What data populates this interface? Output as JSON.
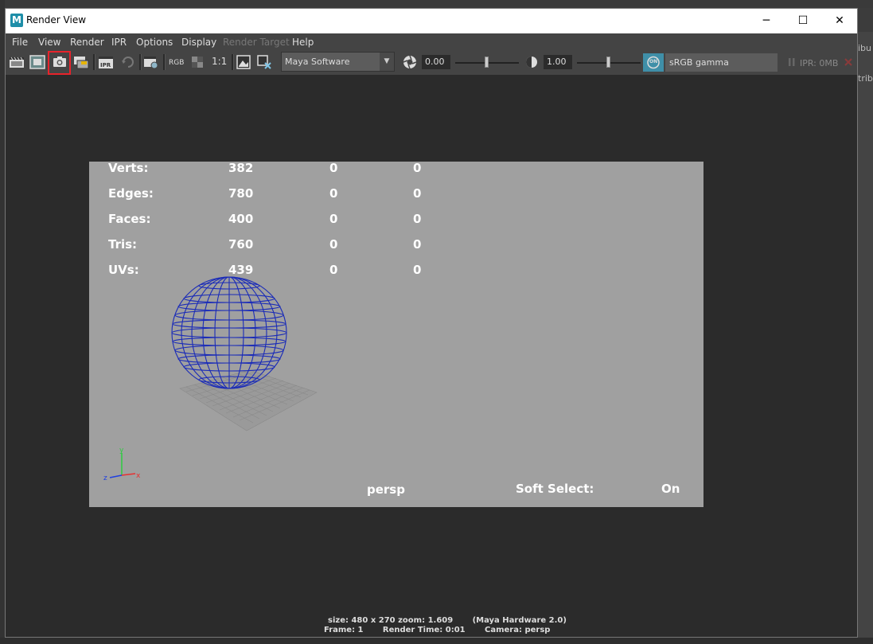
{
  "window": {
    "title": "Render View",
    "logo": "M",
    "minimize_icon": "─",
    "maximize_icon": "☐",
    "close_icon": "✕"
  },
  "menu": [
    "File",
    "View",
    "Render",
    "IPR",
    "Options",
    "Display",
    "Render Target",
    "Help"
  ],
  "menu_disabled": [
    "Render Target"
  ],
  "toolbar": {
    "rgb_label": "RGB",
    "one_to_one": "1:1",
    "renderer": "Maya Software",
    "exposure": "0.00",
    "gamma": "1.00",
    "colorspace": "sRGB gamma",
    "ipr_memory": "IPR: 0MB",
    "cm_badge": "ON"
  },
  "hud": {
    "rows": [
      {
        "label": "Verts:",
        "v1": "382",
        "v2": "0",
        "v3": "0"
      },
      {
        "label": "Edges:",
        "v1": "780",
        "v2": "0",
        "v3": "0"
      },
      {
        "label": "Faces:",
        "v1": "400",
        "v2": "0",
        "v3": "0"
      },
      {
        "label": "Tris:",
        "v1": "760",
        "v2": "0",
        "v3": "0"
      },
      {
        "label": "UVs:",
        "v1": "439",
        "v2": "0",
        "v3": "0"
      }
    ],
    "camera": "persp",
    "soft_select_label": "Soft Select:",
    "soft_select_value": "On",
    "axis_x": "x",
    "axis_y": "y",
    "axis_z": "z"
  },
  "status": {
    "line1": "size: 480 x 270 zoom: 1.609       (Maya Hardware 2.0)",
    "line2": "Frame: 1       Render Time: 0:01       Camera: persp"
  },
  "background_right": [
    "ibu",
    "trib"
  ],
  "colors": {
    "sphere_wire": "#1a2bb8",
    "highlight": "#e8232b",
    "cm_badge": "#3f8fa8"
  }
}
